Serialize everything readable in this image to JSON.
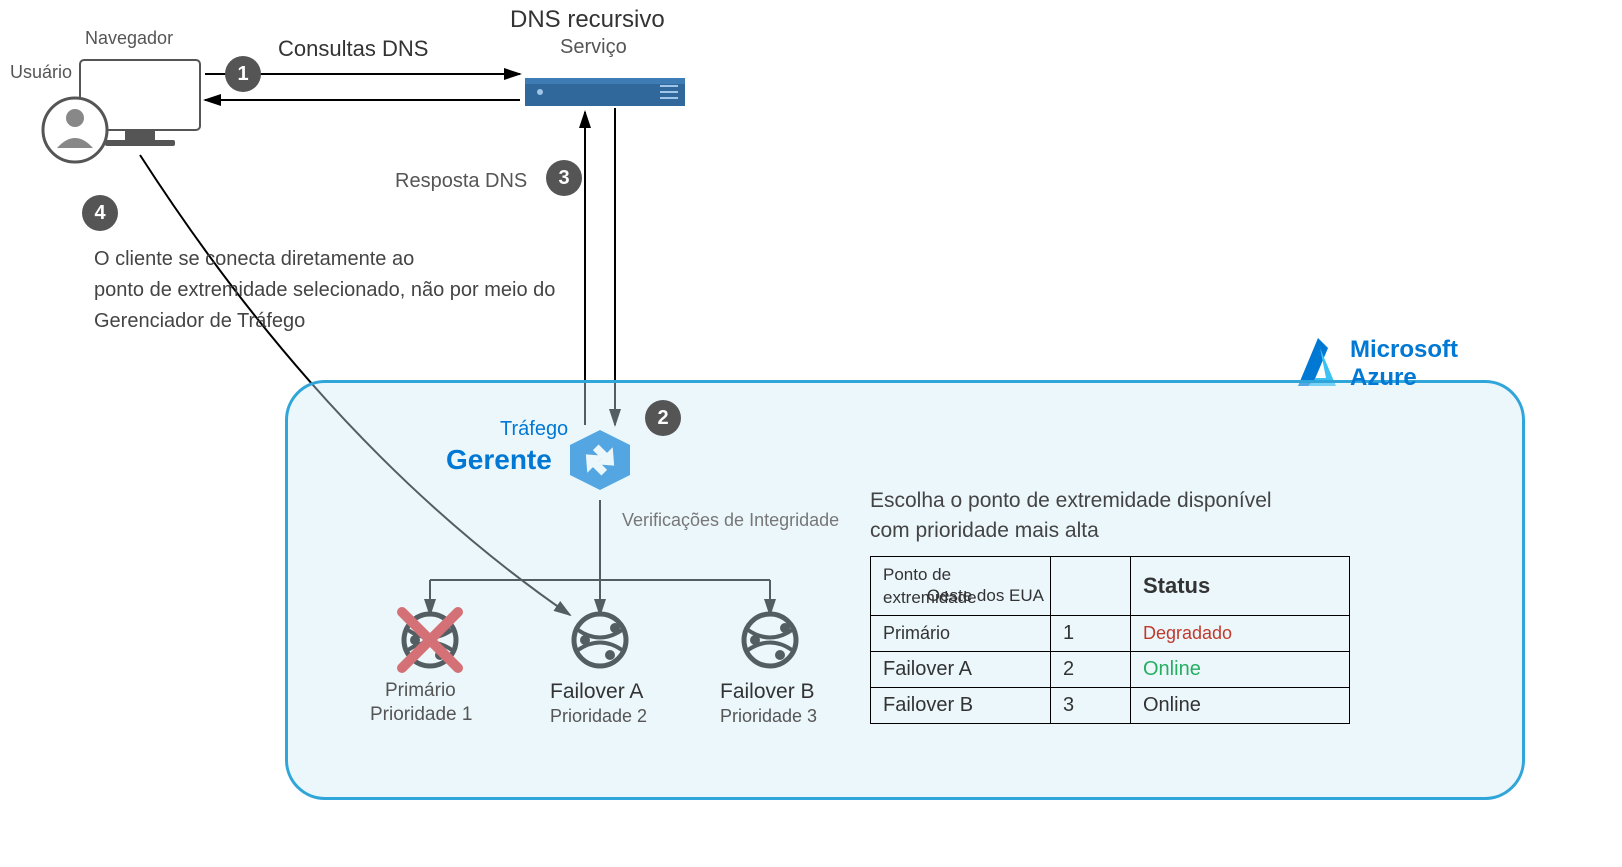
{
  "labels": {
    "navegador": "Navegador",
    "usuario": "Usuário",
    "consultas_dns": "Consultas DNS",
    "dns_recursivo": "DNS recursivo",
    "servico": "Serviço",
    "resposta_dns": "Resposta DNS",
    "trafego": "Tráfego",
    "gerente": "Gerente",
    "health_checks": "Verificações de Integridade",
    "client_text": "O cliente se conecta diretamente ao\nponto de extremidade selecionado, não por meio do\nGerenciador de Tráfego",
    "choose": "Escolha o ponto de extremidade disponível\ncom prioridade mais alta",
    "azure1": "Microsoft",
    "azure2": "Azure"
  },
  "steps": {
    "s1": "1",
    "s2": "2",
    "s3": "3",
    "s4": "4"
  },
  "endpoints": {
    "primary": {
      "name": "Primário",
      "pri": "Prioridade 1"
    },
    "foA": {
      "name": "Failover A",
      "pri": "Prioridade 2"
    },
    "foB": {
      "name": "Failover B",
      "pri": "Prioridade 3"
    }
  },
  "table": {
    "h1": "Ponto de extremidade",
    "h2": "Oeste dos EUA",
    "h3": "Status",
    "rows": [
      {
        "ep": "Primário",
        "pri": "1",
        "status": "Degradado",
        "cls": "deg"
      },
      {
        "ep": "Failover A",
        "pri": "2",
        "status": "Online",
        "cls": "ok"
      },
      {
        "ep": "Failover B",
        "pri": "3",
        "status": "Online",
        "cls": ""
      }
    ]
  }
}
